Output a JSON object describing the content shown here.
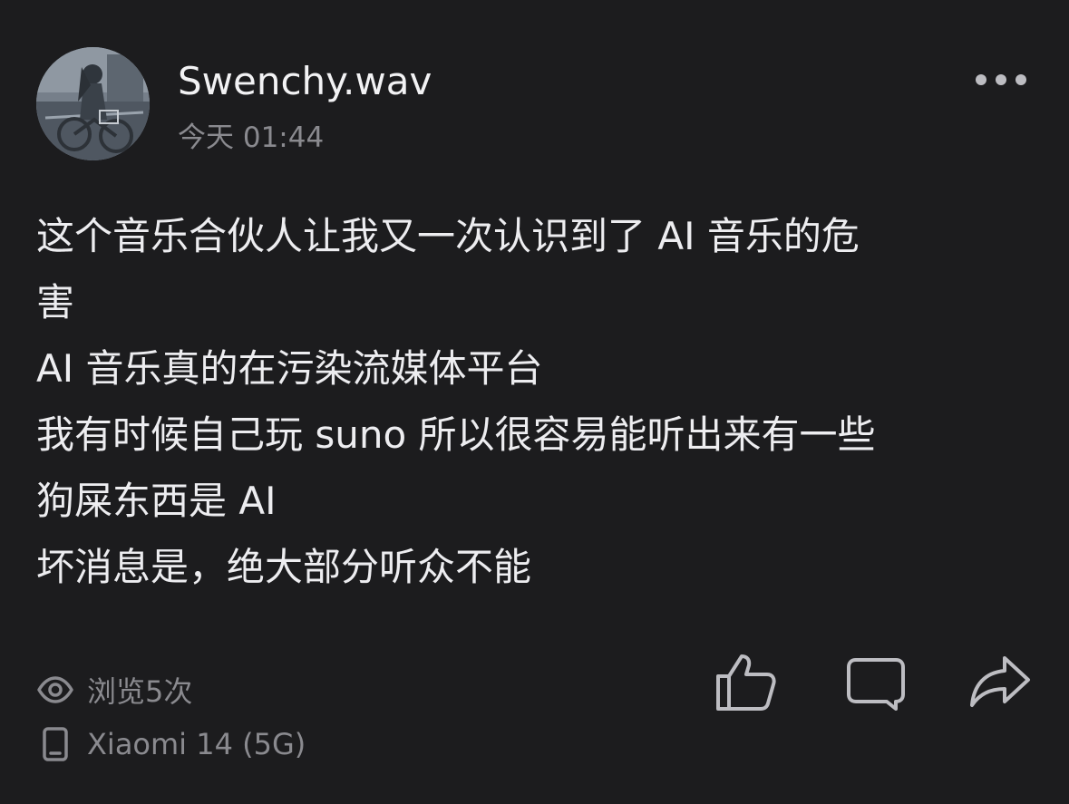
{
  "post": {
    "author": {
      "name": "Swenchy.wav"
    },
    "timestamp": "今天 01:44",
    "lines": [
      "这个音乐合伙人让我又一次认识到了 AI 音乐的危",
      "害",
      "AI 音乐真的在污染流媒体平台",
      "我有时候自己玩 suno 所以很容易能听出来有一些",
      "狗屎东西是 AI",
      "坏消息是，绝大部分听众不能"
    ],
    "views": "浏览5次",
    "device": "Xiaomi 14 (5G)"
  },
  "icons": {
    "more": "more-dots-icon",
    "views": "eye-icon",
    "device": "phone-icon",
    "like": "thumbs-up-icon",
    "comment": "comment-icon",
    "share": "share-icon"
  },
  "colors": {
    "background": "#1c1c1e",
    "primary_text": "#ededf0",
    "secondary_text": "#8a8a8f",
    "icon": "#bdbdc2"
  }
}
